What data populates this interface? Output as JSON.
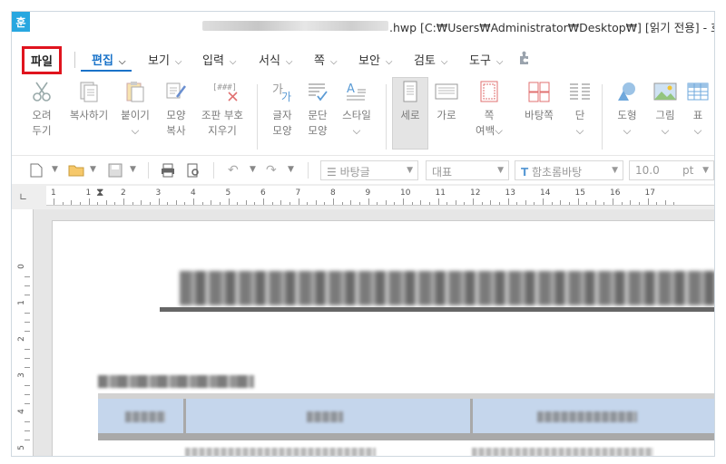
{
  "titlebar": {
    "logo": "훈",
    "title_suffix": ".hwp [C:₩Users₩Administrator₩Desktop₩] [읽기 전용] - 호글"
  },
  "menubar": {
    "file": "파일",
    "items": [
      {
        "label": "편집",
        "active": true
      },
      {
        "label": "보기"
      },
      {
        "label": "입력"
      },
      {
        "label": "서식"
      },
      {
        "label": "쪽"
      },
      {
        "label": "보안"
      },
      {
        "label": "검토"
      },
      {
        "label": "도구"
      }
    ],
    "chevron": "⌵"
  },
  "ribbon": {
    "buttons": [
      {
        "label": "오려\n두기",
        "icon": "scissors-icon"
      },
      {
        "label": "복사하기",
        "icon": "copy-icon"
      },
      {
        "label": "붙이기\n⌵",
        "icon": "paste-icon"
      },
      {
        "label": "모양\n복사",
        "icon": "format-painter-icon"
      },
      {
        "label": "조판 부호\n지우기",
        "icon": "clear-codes-icon"
      },
      {
        "label": "글자\n모양",
        "icon": "char-shape-icon"
      },
      {
        "label": "문단\n모양",
        "icon": "para-shape-icon"
      },
      {
        "label": "스타일\n⌵",
        "icon": "style-icon"
      },
      {
        "label": "세로",
        "icon": "portrait-icon"
      },
      {
        "label": "가로",
        "icon": "landscape-icon"
      },
      {
        "label": "쪽\n여백⌵",
        "icon": "margin-icon"
      },
      {
        "label": "바탕쪽",
        "icon": "master-page-icon"
      },
      {
        "label": "단\n⌵",
        "icon": "columns-icon"
      },
      {
        "label": "도형\n⌵",
        "icon": "shape-icon"
      },
      {
        "label": "그림\n⌵",
        "icon": "picture-icon"
      },
      {
        "label": "표\n⌵",
        "icon": "table-icon"
      }
    ],
    "icon_text": {
      "clear_codes": "[###]",
      "char_shape": "가",
      "style": "A"
    }
  },
  "toolbar": {
    "style_field": "바탕글",
    "style_icon": "☰",
    "lang_field": "대표",
    "font_field": "함초롬바탕",
    "font_icon": "T",
    "size_field": "10.0",
    "size_unit": "pt"
  },
  "ruler": {
    "corner": "∟",
    "numbers": [
      "1",
      "1",
      "2",
      "3",
      "4",
      "5",
      "6",
      "7",
      "8",
      "9",
      "10",
      "11",
      "12",
      "13",
      "14",
      "15",
      "16",
      "17"
    ],
    "vnumbers": [
      "0",
      "1",
      "2",
      "3",
      "4",
      "5"
    ]
  },
  "colors": {
    "accent": "#1a73c9",
    "logo": "#28a7e0",
    "highlight_box": "#e0141e",
    "table_header": "#c5d6ec"
  }
}
